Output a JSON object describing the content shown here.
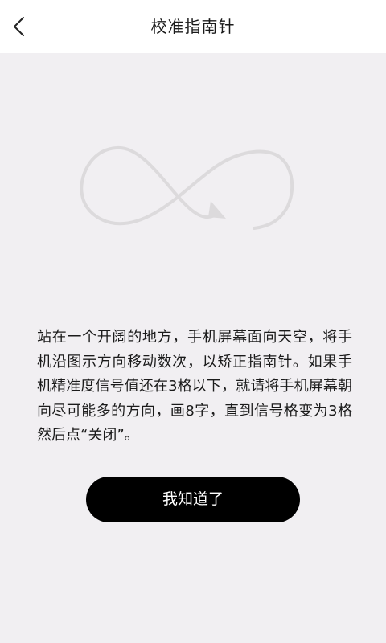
{
  "header": {
    "back_icon": "chevron-left-icon",
    "title": "校准指南针"
  },
  "illustration": {
    "icon": "figure-eight-arrow-icon",
    "stroke_color": "#dcdadc"
  },
  "instructions": {
    "text": "站在一个开阔的地方，手机屏幕面向天空，将手机沿图示方向移动数次，以矫正指南针。如果手机精准度信号值还在3格以下，就请将手机屏幕朝向尽可能多的方向，画8字，直到信号格变为3格然后点“关闭”。"
  },
  "actions": {
    "confirm_label": "我知道了"
  },
  "colors": {
    "background": "#f1eff2",
    "header": "#ffffff",
    "button": "#000000",
    "button_text": "#ffffff"
  }
}
